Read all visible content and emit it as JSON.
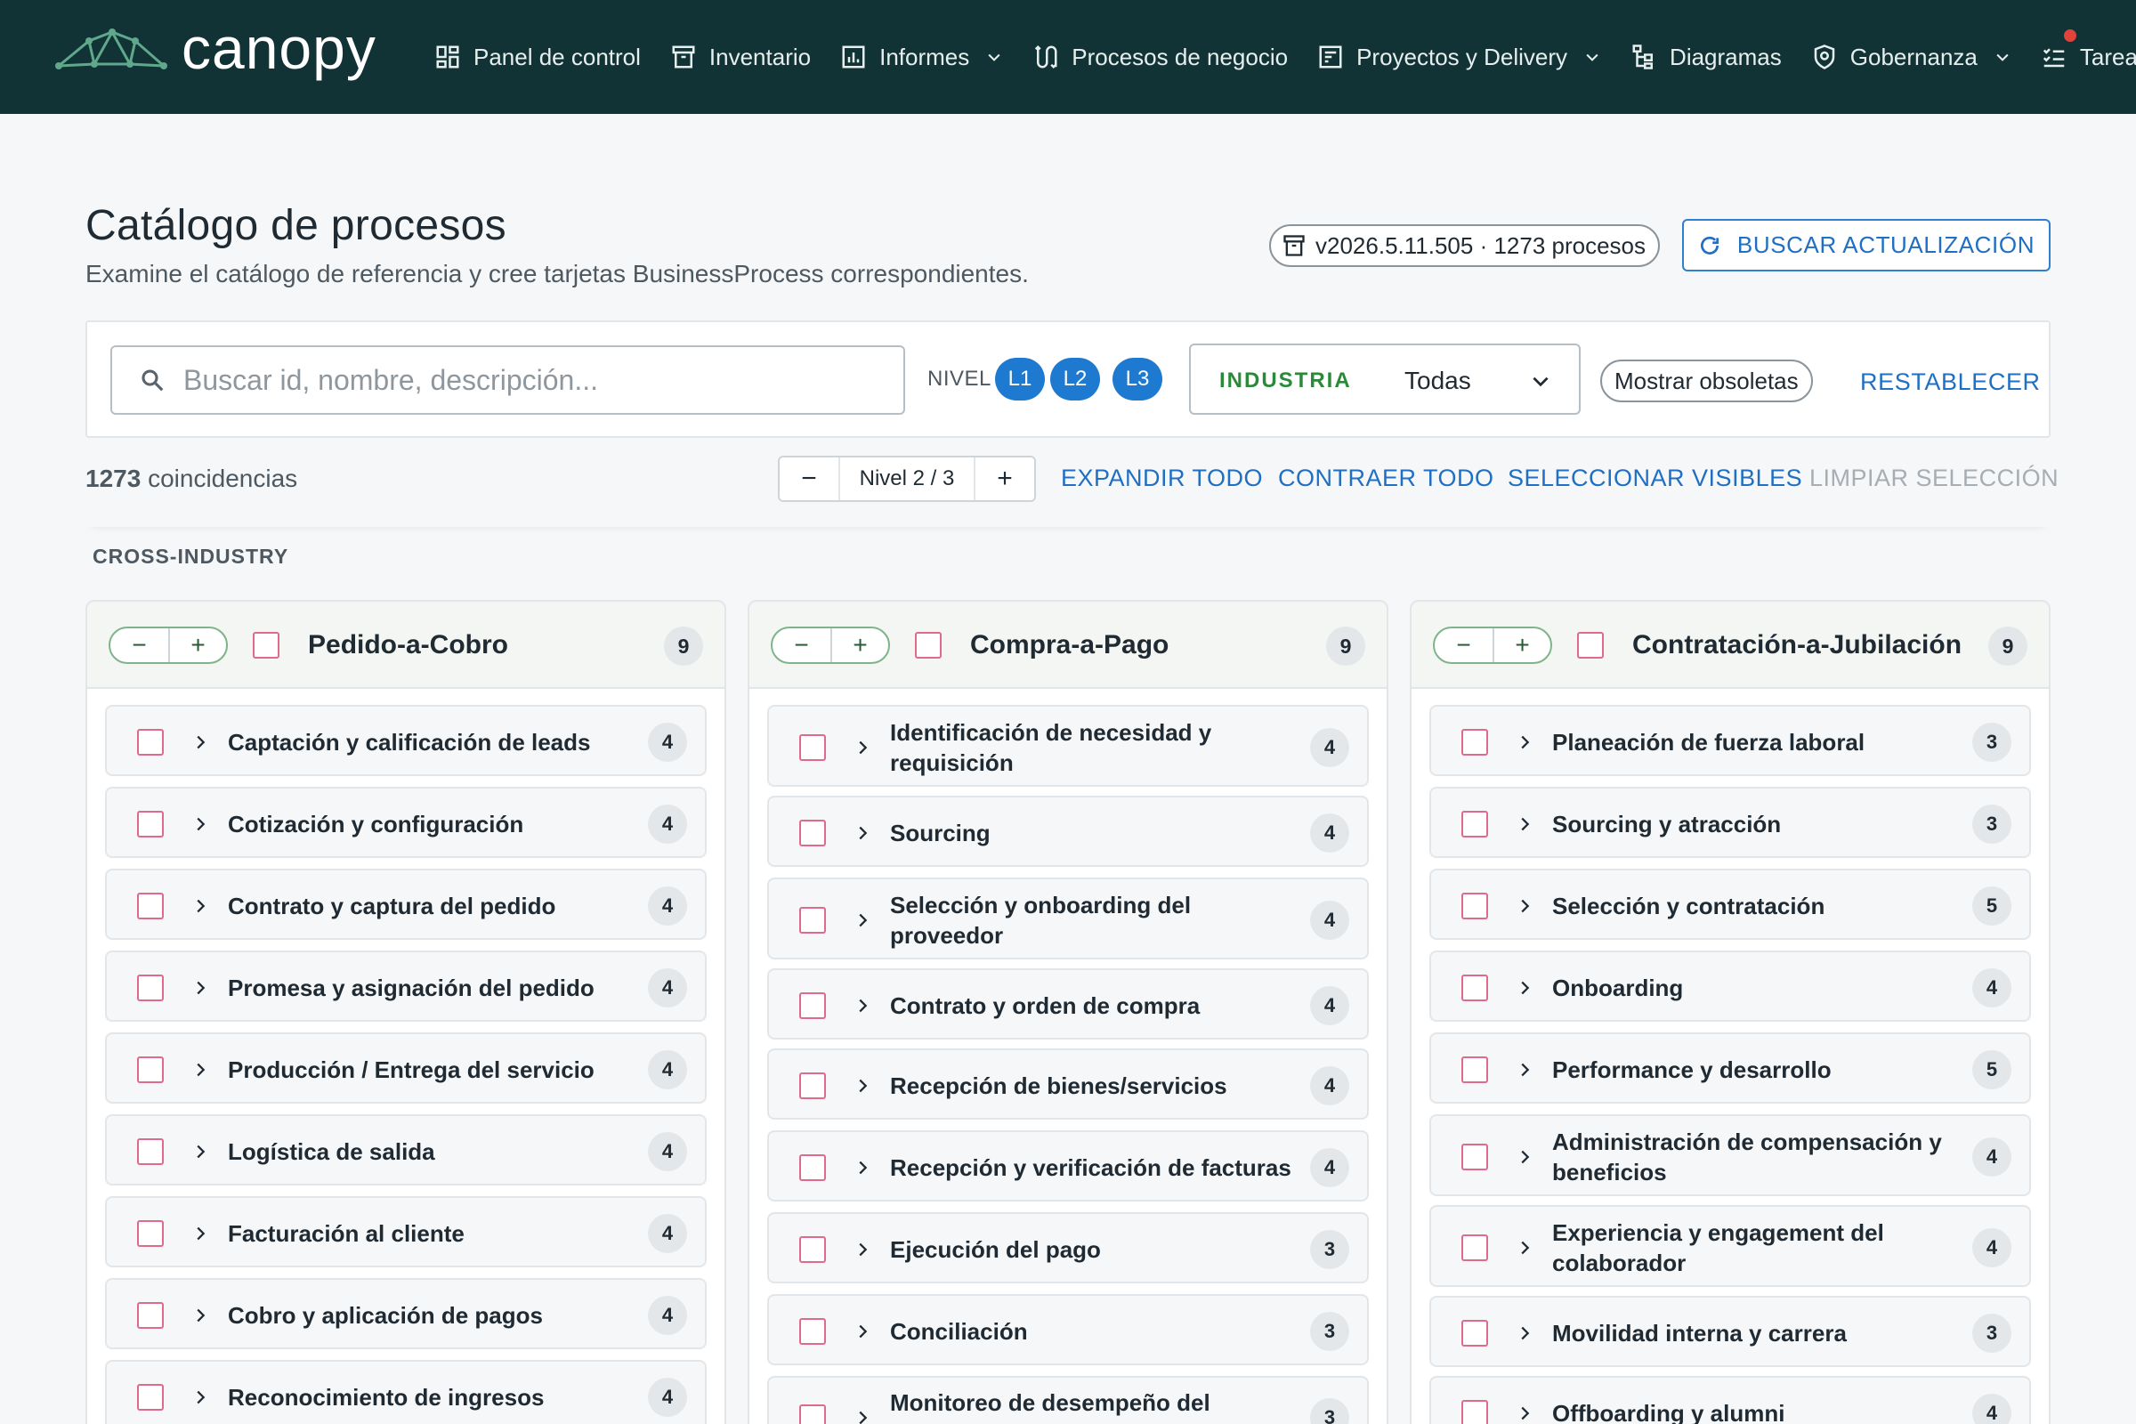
{
  "brand": {
    "name": "canopy"
  },
  "nav": [
    {
      "label": "Panel de control",
      "icon": "dashboard-icon",
      "dropdown": false
    },
    {
      "label": "Inventario",
      "icon": "archive-icon",
      "dropdown": false
    },
    {
      "label": "Informes",
      "icon": "bar-chart-icon",
      "dropdown": true
    },
    {
      "label": "Procesos de negocio",
      "icon": "process-icon",
      "dropdown": false
    },
    {
      "label": "Proyectos y Delivery",
      "icon": "project-icon",
      "dropdown": true
    },
    {
      "label": "Diagramas",
      "icon": "diagram-icon",
      "dropdown": false
    },
    {
      "label": "Gobernanza",
      "icon": "shield-icon",
      "dropdown": true
    },
    {
      "label": "Tareas",
      "icon": "tasks-icon",
      "dropdown": false,
      "notification": true
    }
  ],
  "header": {
    "title": "Catálogo de procesos",
    "subtitle": "Examine el catálogo de referencia y cree tarjetas BusinessProcess correspondientes.",
    "version": "v2026.5.11.505 · 1273 procesos",
    "update_button": "BUSCAR ACTUALIZACIÓN"
  },
  "filters": {
    "search_placeholder": "Buscar id, nombre, descripción...",
    "search_value": "",
    "level_label": "NIVEL",
    "levels": [
      "L1",
      "L2",
      "L3"
    ],
    "industry_label": "INDUSTRIA",
    "industry_value": "Todas",
    "obsolete_label": "Mostrar obsoletas",
    "reset_label": "RESTABLECER"
  },
  "toolbar": {
    "match_count": "1273",
    "match_suffix": " coincidencias",
    "level_stepper": "Nivel 2 / 3",
    "expand_all": "EXPANDIR TODO",
    "collapse_all": "CONTRAER TODO",
    "select_visible": "SELECCIONAR VISIBLES",
    "clear_selection": "LIMPIAR SELECCIÓN"
  },
  "section": {
    "label": "CROSS-INDUSTRY"
  },
  "columns": [
    {
      "title": "Pedido-a-Cobro",
      "count": "9",
      "items": [
        {
          "label": "Captación y calificación de leads",
          "count": "4"
        },
        {
          "label": "Cotización y configuración",
          "count": "4"
        },
        {
          "label": "Contrato y captura del pedido",
          "count": "4"
        },
        {
          "label": "Promesa y asignación del pedido",
          "count": "4"
        },
        {
          "label": "Producción / Entrega del servicio",
          "count": "4"
        },
        {
          "label": "Logística de salida",
          "count": "4"
        },
        {
          "label": "Facturación al cliente",
          "count": "4"
        },
        {
          "label": "Cobro y aplicación de pagos",
          "count": "4"
        },
        {
          "label": "Reconocimiento de ingresos",
          "count": "4"
        }
      ]
    },
    {
      "title": "Compra-a-Pago",
      "count": "9",
      "items": [
        {
          "label": "Identificación de necesidad y requisición",
          "count": "4"
        },
        {
          "label": "Sourcing",
          "count": "4"
        },
        {
          "label": "Selección y onboarding del proveedor",
          "count": "4"
        },
        {
          "label": "Contrato y orden de compra",
          "count": "4"
        },
        {
          "label": "Recepción de bienes/servicios",
          "count": "4"
        },
        {
          "label": "Recepción y verificación de facturas",
          "count": "4"
        },
        {
          "label": "Ejecución del pago",
          "count": "3"
        },
        {
          "label": "Conciliación",
          "count": "3"
        },
        {
          "label": "Monitoreo de desempeño del",
          "count": "3"
        }
      ]
    },
    {
      "title": "Contratación-a-Jubilación",
      "count": "9",
      "items": [
        {
          "label": "Planeación de fuerza laboral",
          "count": "3"
        },
        {
          "label": "Sourcing y atracción",
          "count": "3"
        },
        {
          "label": "Selección y contratación",
          "count": "5"
        },
        {
          "label": "Onboarding",
          "count": "4"
        },
        {
          "label": "Performance y desarrollo",
          "count": "5"
        },
        {
          "label": "Administración de compensación y beneficios",
          "count": "4"
        },
        {
          "label": "Experiencia y engagement del colaborador",
          "count": "4"
        },
        {
          "label": "Movilidad interna y carrera",
          "count": "3"
        },
        {
          "label": "Offboarding y alumni",
          "count": "4"
        }
      ]
    }
  ]
}
